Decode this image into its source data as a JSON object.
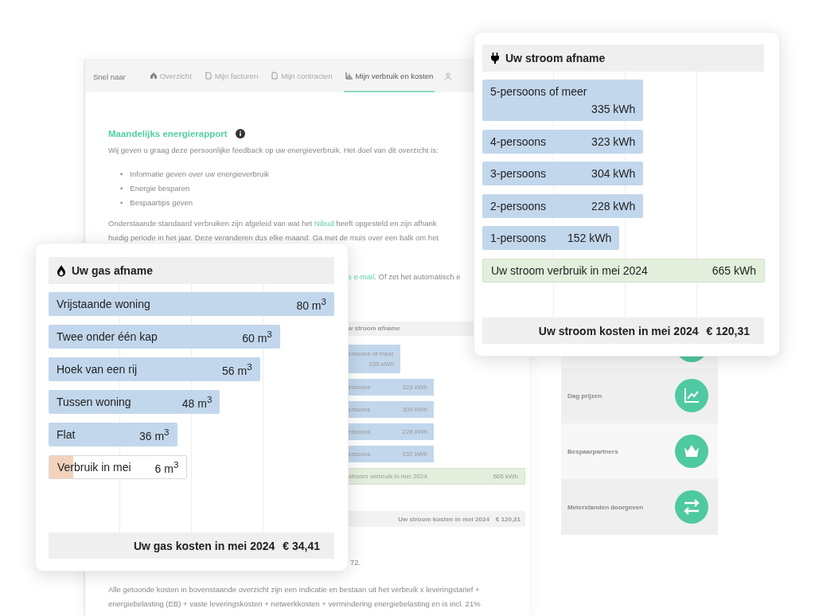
{
  "background_page": {
    "nav": {
      "label": "Snel naar",
      "tabs": [
        {
          "label": "Overzicht",
          "selected": false
        },
        {
          "label": "Mijn facturen",
          "selected": false
        },
        {
          "label": "Mijn contracten",
          "selected": false
        },
        {
          "label": "Mijn verbruik en kosten",
          "selected": true
        }
      ]
    },
    "title": "Maandelijks energierapport",
    "intro": "Wij geven u graag deze persoonlijke feedback op uw energieverbruik. Het doel van dit overzicht is:",
    "goals": [
      {
        "marker": "•",
        "text": "Informatie geven over uw energieverbruik"
      },
      {
        "marker": "•",
        "text": "Energie besparen"
      },
      {
        "marker": "•",
        "text": "Bespaartips geven"
      }
    ],
    "explanation": {
      "before": "Onderstaande standaard verbruiken zijn afgeleid van wat het",
      "link": "Nibud",
      "after": "heeft opgesteld en zijn afhank",
      "line_2": "huidig periode in het jaar. Deze veranderen dus elke maand. Ga met de muis over een balk om het"
    },
    "fragment": {
      "link": "s e-mail",
      "after": ". Of zet het automatisch e"
    },
    "stroom_chart": {
      "title": "w stroom afname",
      "bars": [
        {
          "kind": "reference",
          "label": "ersoons of meer",
          "value": "335 kWh"
        },
        {
          "kind": "reference",
          "label": "ersoons",
          "value": "323 kWh"
        },
        {
          "kind": "reference",
          "label": "ersoons",
          "value": "304 kWh"
        },
        {
          "kind": "reference",
          "label": "ersoons",
          "value": "228 kWh"
        },
        {
          "kind": "reference",
          "label": "ersoons",
          "value": "152 kWh"
        },
        {
          "kind": "total",
          "label": "stroom verbruik in mei 2024",
          "value": "665 kWh"
        }
      ],
      "cost_label": "Uw stroom kosten in mei 2024",
      "cost_value": "€ 120,31"
    },
    "footnote_fragment": "72.",
    "costs_note": [
      "Alle getoonde kosten in bovenstaande overzicht zijn een indicatie en bestaan uit het verbruik x leveringstarief +",
      "energiebelasting (EB) + vaste leveringskosten + netwerkkosten + vermindering energiebelasting en is incl. 21%"
    ],
    "sidebar": [
      {
        "label": "Dag prijzen"
      },
      {
        "label": "Bespaarpartners"
      },
      {
        "label": "Meterstanden doorgeven"
      }
    ]
  },
  "gas_card": {
    "title": "Uw gas afname",
    "bars": [
      {
        "kind": "reference",
        "label": "Vrijstaande woning",
        "value": "80 m$^{3}$",
        "level": 1
      },
      {
        "kind": "reference",
        "label": "Twee onder één kap",
        "value": "60 m$^{3}$",
        "level": 0.81
      },
      {
        "kind": "reference",
        "label": "Hoek van een rij",
        "value": "56 m$^{3}$",
        "level": 0.74
      },
      {
        "kind": "reference",
        "label": "Tussen woning",
        "value": "48 m$^{3}$",
        "level": 0.6
      },
      {
        "kind": "reference",
        "label": "Flat",
        "value": "36 m$^{3}$",
        "level": 0.45
      },
      {
        "kind": "actual",
        "label": "Verbruik in mei",
        "value": "6 m$^{3}$",
        "level": 0.083
      }
    ],
    "cost_label": "Uw gas kosten in mei 2024",
    "cost_value": "€ 34,41"
  },
  "stroom_card": {
    "title": "Uw stroom afname",
    "bars": [
      {
        "kind": "reference",
        "label": "5-persoons of meer",
        "value": "335 kWh",
        "level": 0.57
      },
      {
        "kind": "reference",
        "label": "4-persoons",
        "value": "323 kWh",
        "level": 0.57
      },
      {
        "kind": "reference",
        "label": "3-persoons",
        "value": "304 kWh",
        "level": 0.57
      },
      {
        "kind": "reference",
        "label": "2-persoons",
        "value": "228 kWh",
        "level": 0.57
      },
      {
        "kind": "reference",
        "label": "1-persoons",
        "value": "152 kWh",
        "level": 0.485
      },
      {
        "kind": "total",
        "label": "Uw stroom verbruik in mei 2024",
        "value": "665 kWh",
        "level": 1
      }
    ],
    "cost_label": "Uw stroom kosten in mei 2024",
    "cost_value": "€ 120,31"
  }
}
